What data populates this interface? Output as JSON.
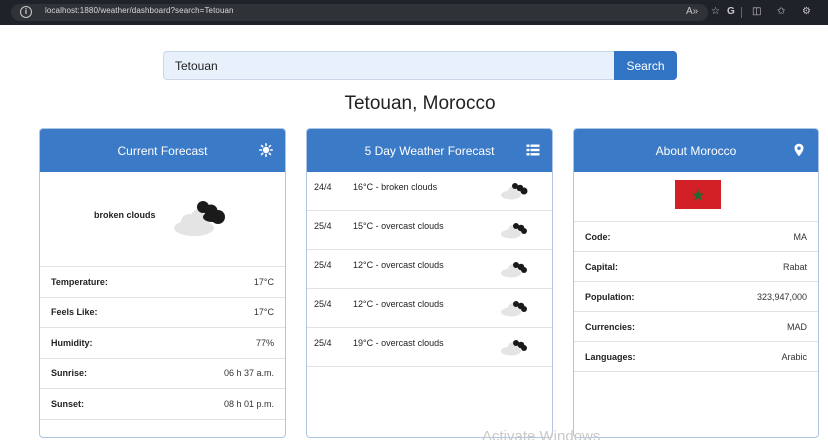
{
  "browser": {
    "url": "localhost:1880/weather/dashboard?search=Tetouan",
    "info_glyph": "i",
    "icons": [
      "read-aloud-icon",
      "favorite-star-icon",
      "copilot-icon",
      "split-screen-icon",
      "favorites-icon",
      "extensions-icon"
    ]
  },
  "search": {
    "value": "Tetouan",
    "button_label": "Search"
  },
  "location_title": "Tetouan, Morocco",
  "current": {
    "header": "Current Forecast",
    "description": "broken clouds",
    "rows": [
      {
        "label": "Temperature:",
        "value": "17°C"
      },
      {
        "label": "Feels Like:",
        "value": "17°C"
      },
      {
        "label": "Humidity:",
        "value": "77%"
      },
      {
        "label": "Sunrise:",
        "value": "06 h 37 a.m."
      },
      {
        "label": "Sunset:",
        "value": "08 h 01 p.m."
      }
    ]
  },
  "forecast": {
    "header": "5 Day Weather Forecast",
    "items": [
      {
        "date": "24/4",
        "text": "16°C - broken clouds"
      },
      {
        "date": "25/4",
        "text": "15°C - overcast clouds"
      },
      {
        "date": "25/4",
        "text": "12°C - overcast clouds"
      },
      {
        "date": "25/4",
        "text": "12°C - overcast clouds"
      },
      {
        "date": "25/4",
        "text": "19°C - overcast clouds"
      }
    ]
  },
  "country": {
    "header": "About Morocco",
    "rows": [
      {
        "label": "Code:",
        "value": "MA"
      },
      {
        "label": "Capital:",
        "value": "Rabat"
      },
      {
        "label": "Population:",
        "value": "323,947,000"
      },
      {
        "label": "Currencies:",
        "value": "MAD"
      },
      {
        "label": "Languages:",
        "value": "Arabic"
      }
    ]
  },
  "colors": {
    "accent": "#3a7ac6",
    "flag_red": "#d31f26",
    "flag_star": "#1f6b2f"
  },
  "watermark": "Activate Windows"
}
